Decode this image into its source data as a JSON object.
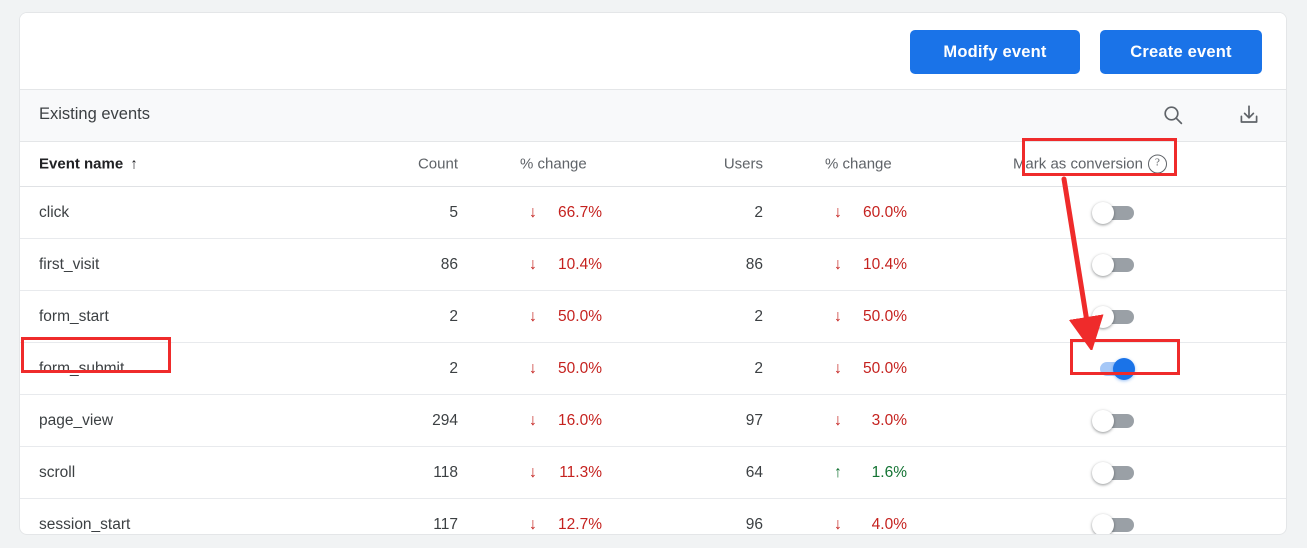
{
  "toolbar": {
    "modify_label": "Modify event",
    "create_label": "Create event",
    "button_color": "#1a73e8"
  },
  "panel": {
    "title": "Existing events",
    "search_icon": "search-icon",
    "download_icon": "download-icon"
  },
  "table": {
    "columns": {
      "event_name": "Event name",
      "sort_arrow": "↑",
      "count": "Count",
      "count_change": "% change",
      "users": "Users",
      "users_change": "% change",
      "mark_as_conversion": "Mark as conversion",
      "help_icon": "?"
    },
    "rows": [
      {
        "name": "click",
        "count": "5",
        "count_change": "66.7%",
        "count_dir": "down",
        "users": "2",
        "users_change": "60.0%",
        "users_dir": "down",
        "conversion": false
      },
      {
        "name": "first_visit",
        "count": "86",
        "count_change": "10.4%",
        "count_dir": "down",
        "users": "86",
        "users_change": "10.4%",
        "users_dir": "down",
        "conversion": false
      },
      {
        "name": "form_start",
        "count": "2",
        "count_change": "50.0%",
        "count_dir": "down",
        "users": "2",
        "users_change": "50.0%",
        "users_dir": "down",
        "conversion": false
      },
      {
        "name": "form_submit",
        "count": "2",
        "count_change": "50.0%",
        "count_dir": "down",
        "users": "2",
        "users_change": "50.0%",
        "users_dir": "down",
        "conversion": true
      },
      {
        "name": "page_view",
        "count": "294",
        "count_change": "16.0%",
        "count_dir": "down",
        "users": "97",
        "users_change": "3.0%",
        "users_dir": "down",
        "conversion": false
      },
      {
        "name": "scroll",
        "count": "118",
        "count_change": "11.3%",
        "count_dir": "down",
        "users": "64",
        "users_change": "1.6%",
        "users_dir": "up",
        "conversion": false
      },
      {
        "name": "session_start",
        "count": "117",
        "count_change": "12.7%",
        "count_dir": "down",
        "users": "96",
        "users_change": "4.0%",
        "users_dir": "down",
        "conversion": false
      }
    ]
  },
  "annotations": {
    "color": "#ef2b2b",
    "highlight_header": "Mark as conversion",
    "highlight_row": "form_submit",
    "highlight_toggle": "form_submit conversion toggle",
    "arrow": "points from Mark as conversion column header down to form_submit toggle"
  },
  "colors": {
    "decrease": "#c5221f",
    "increase": "#137333",
    "toggle_on": "#1a73e8",
    "toggle_off": "#9aa0a6"
  }
}
